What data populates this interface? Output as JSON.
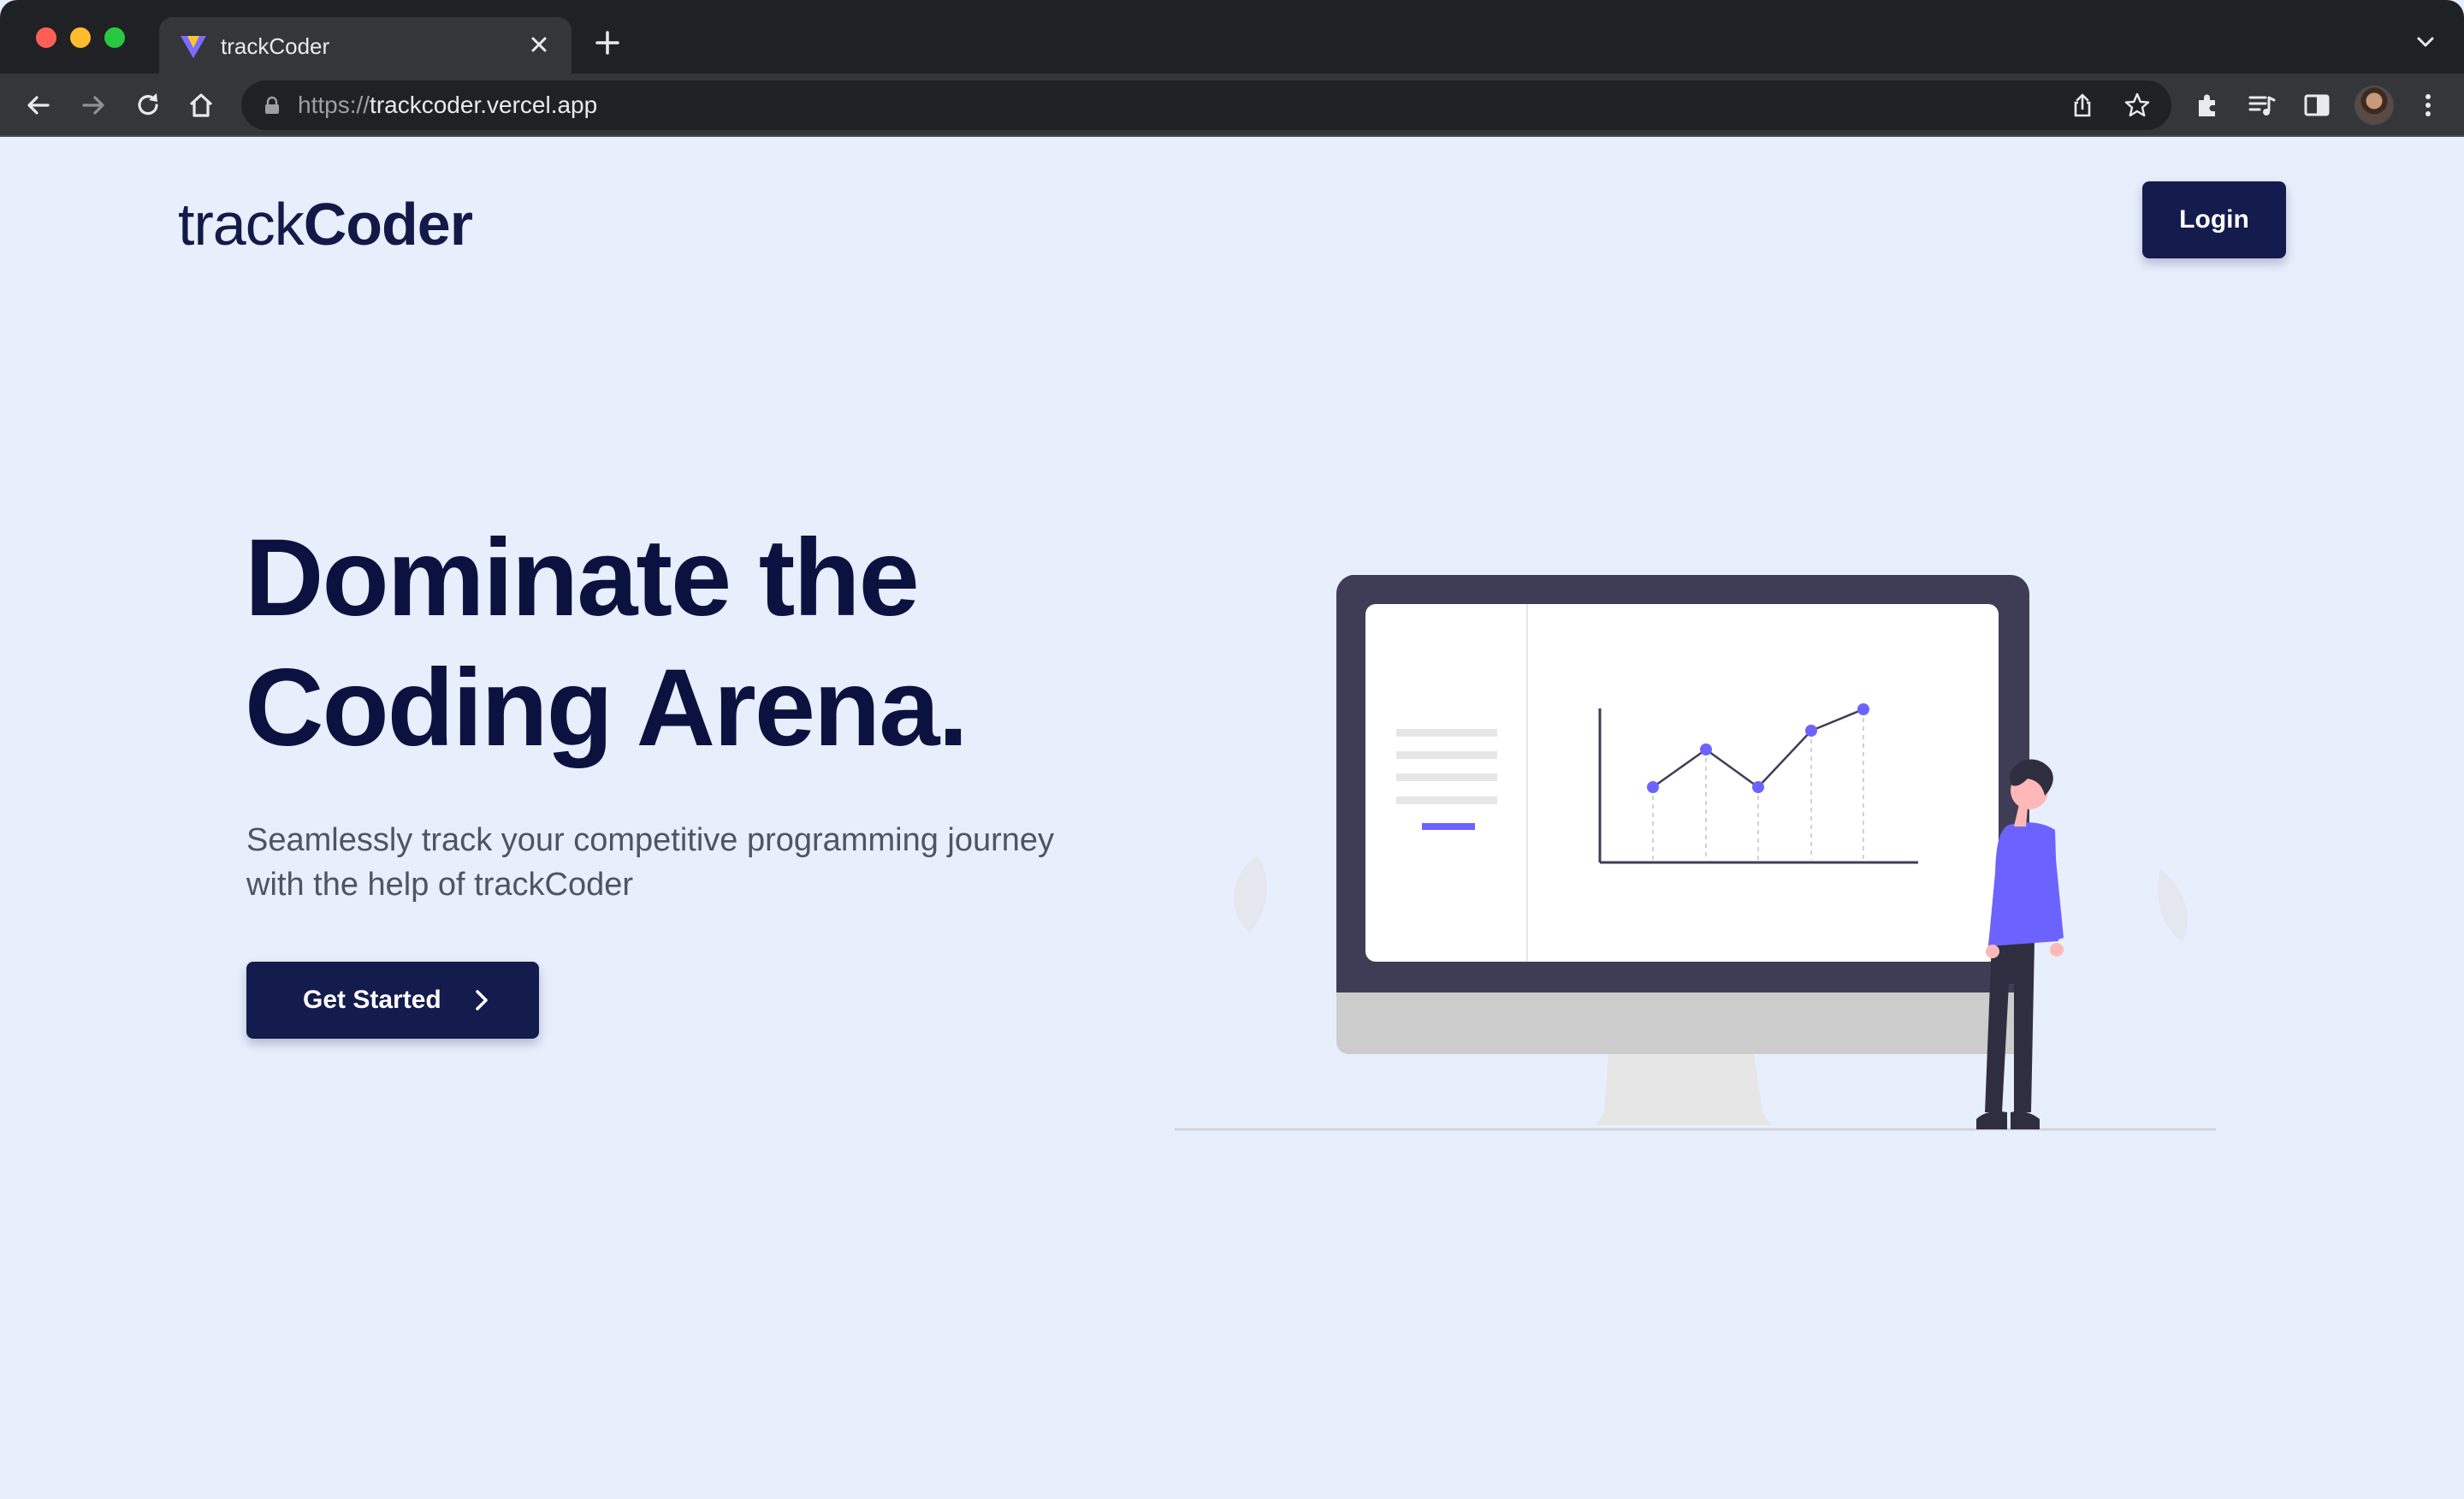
{
  "browser": {
    "tab_title": "trackCoder",
    "url_scheme": "https://",
    "url_host": "trackcoder.vercel.app",
    "icons": [
      "back-icon",
      "forward-icon",
      "reload-icon",
      "home-icon",
      "lock-icon",
      "share-icon",
      "bookmark-star-icon",
      "extensions-icon",
      "media-playlist-icon",
      "side-panel-icon",
      "profile-avatar",
      "more-menu-icon"
    ]
  },
  "header": {
    "logo_light": "track",
    "logo_bold": "Coder",
    "login_label": "Login"
  },
  "hero": {
    "title_line1": "Dominate the",
    "title_line2": "Coding Arena.",
    "subtitle_line1": "Seamlessly track your competitive programming journey",
    "subtitle_line2": "with the help of trackCoder",
    "cta_label": "Get Started"
  },
  "colors": {
    "page_background": "#e8effc",
    "navy": "#141b4d",
    "accent_purple": "#6c63ff",
    "monitor_frame": "#3f3d56"
  }
}
